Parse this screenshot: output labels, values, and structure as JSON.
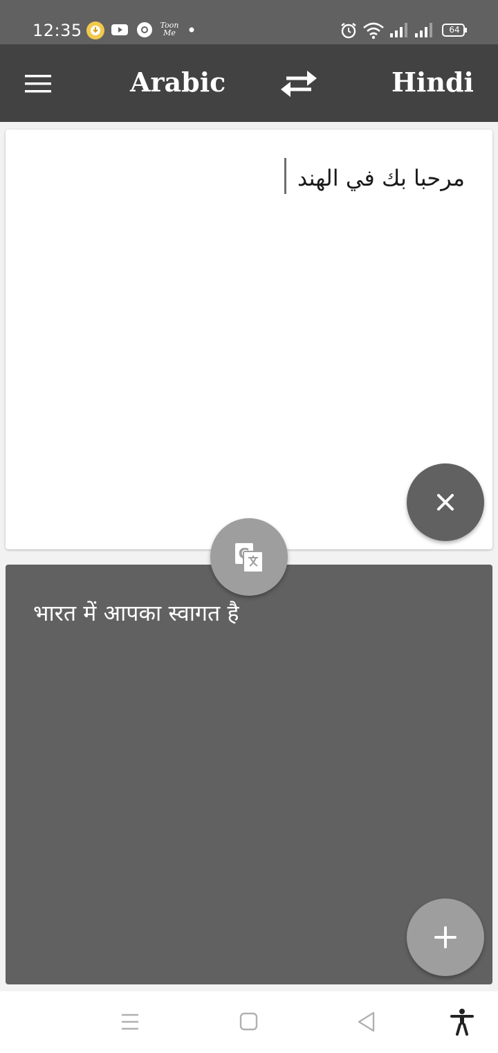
{
  "status_bar": {
    "time": "12:35",
    "toon_me": "Toon Me",
    "battery": "64",
    "icons": [
      "download-badge-icon",
      "youtube-icon",
      "chrome-icon",
      "toonme-icon",
      "dot-icon",
      "alarm-icon",
      "wifi-icon",
      "signal-icon",
      "signal-icon",
      "battery-icon"
    ]
  },
  "app_bar": {
    "source_language": "Arabic",
    "target_language": "Hindi",
    "icons": [
      "menu-icon",
      "swap-icon"
    ]
  },
  "input": {
    "text": "مرحبا بك في الهند"
  },
  "output": {
    "text": "भारत में आपका स्वागत है"
  },
  "buttons": {
    "clear_icon": "close-icon",
    "translate_icon": "translate-icon",
    "add_icon": "plus-icon"
  },
  "nav_bar": {
    "icons": [
      "recents-icon",
      "home-icon",
      "back-icon",
      "accessibility-icon"
    ]
  },
  "colors": {
    "status_bar": "#616161",
    "app_bar": "#424242",
    "output_card": "#616161",
    "fab_light": "#9e9e9e",
    "fab_dark": "#616161"
  }
}
